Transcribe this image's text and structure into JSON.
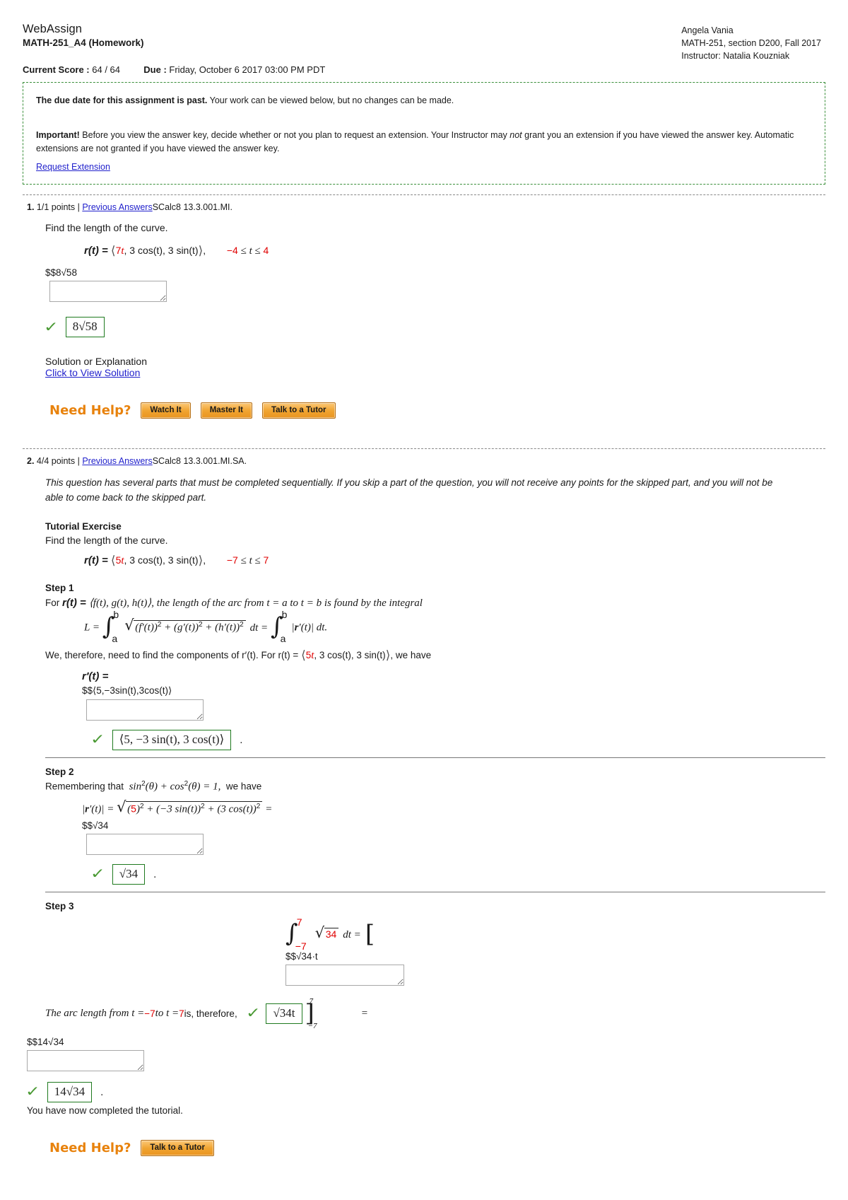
{
  "header": {
    "brand": "WebAssign",
    "assignment": "MATH-251_A4 (Homework)",
    "student": "Angela Vania",
    "course": "MATH-251, section D200, Fall 2017",
    "instructor": "Instructor: Natalia Kouzniak",
    "score_label": "Current Score :",
    "score_value": "64 / 64",
    "due_label": "Due :",
    "due_value": "Friday, October 6 2017 03:00 PM PDT"
  },
  "notice": {
    "past_due_bold": "The due date for this assignment is past.",
    "past_due_rest": " Your work can be viewed below, but no changes can be made.",
    "important_bold": "Important!",
    "important_rest_1": " Before you view the answer key, decide whether or not you plan to request an extension. Your Instructor may ",
    "important_italic": "not",
    "important_rest_2": " grant you an extension if you have viewed the answer key. Automatic extensions are not granted if you have viewed the answer key.",
    "request_extension_link": "Request Extension",
    "border_color": "#3a8f3a"
  },
  "question1": {
    "number": "1.",
    "points": "1/1 points |",
    "previous_answers_link": "Previous Answers",
    "problem_id": "SCalc8 13.3.001.MI.",
    "prompt": "Find the length of the curve.",
    "equation": {
      "lhs": "r(t) = ",
      "open_angle": "⟨",
      "coef": "7",
      "var": "t",
      "rest": ", 3 cos(t), 3 sin(t)",
      "close_angle": "⟩",
      "comma": ",",
      "domain_lo": "−4",
      "domain_mid": " ≤ t ≤ ",
      "domain_hi": "4"
    },
    "raw_answer": "$$8√58",
    "input_value": "",
    "correct_answer": "8√58",
    "solution_title": "Solution or Explanation",
    "solution_link": "Click to View Solution",
    "need_help_label": "Need Help?",
    "need_help_buttons": [
      "Watch It",
      "Master It",
      "Talk to a Tutor"
    ]
  },
  "question2": {
    "number": "2.",
    "points": "4/4 points |",
    "previous_answers_link": "Previous Answers",
    "problem_id": "SCalc8 13.3.001.MI.SA.",
    "sequential_note": "This question has several parts that must be completed sequentially. If you skip a part of the question, you will not receive any points for the skipped part, and you will not be able to come back to the skipped part.",
    "tutorial_title": "Tutorial Exercise",
    "prompt": "Find the length of the curve.",
    "equation": {
      "lhs": "r(t) = ",
      "open_angle": "⟨",
      "coef": "5",
      "var": "t",
      "rest": ", 3 cos(t), 3 sin(t)",
      "close_angle": "⟩",
      "comma": ",",
      "domain_lo": "−7",
      "domain_mid": " ≤ t ≤ ",
      "domain_hi": "7"
    },
    "step1": {
      "title": "Step 1",
      "intro_a": "For ",
      "intro_r": "r(t) = ",
      "intro_components": "⟨f(t), g(t), h(t)⟩",
      "intro_b": ",  the length of the arc from t = a to t = b is found by the integral",
      "formula_L": "L = ",
      "formula_lower": "a",
      "formula_upper": "b",
      "formula_radicand": "(f′(t))2 + (g′(t))2 + (h′(t))2",
      "formula_dt": "dt = ",
      "formula_abs": "|r′(t)| dt.",
      "text_after": "We, therefore, need to find the components of  r′(t).  For  r(t) = ",
      "text_after_vec": ", 3 cos(t), 3 sin(t)",
      "text_after_end": ",  we have",
      "rprime_label": "r′(t) =",
      "raw_answer": "$$⟨5,−3sin(t),3cos(t)⟩",
      "input_value": "",
      "correct_answer": "⟨5, −3 sin(t), 3 cos(t)⟩"
    },
    "step2": {
      "title": "Step 2",
      "intro": "Remembering that  sin2(θ) + cos2(θ) = 1,  we have",
      "lhs": "|r′(t)| = ",
      "radicand_coef": "5",
      "radicand_rest": ")2 + (−3 sin(t))2 + (3 cos(t))2",
      "equals": "=",
      "raw_answer": "$$√34",
      "input_value": "",
      "correct_answer": "√34"
    },
    "step3": {
      "title": "Step 3",
      "int_lower": "−7",
      "int_upper": "7",
      "int_radicand": "34",
      "int_dt": "dt =",
      "raw_answer": "$$√34·t",
      "input_value": "",
      "arc_text_a": "The arc length from t = ",
      "arc_lo": "−7",
      "arc_text_b": " to t = ",
      "arc_hi": "7",
      "arc_text_c": " is, therefore,",
      "correct_answer_inline": "√34t",
      "eval_upper": "7",
      "eval_lower": "−7",
      "equals": "=",
      "final_raw_answer": "$$14√34",
      "final_input_value": "",
      "final_correct_answer": "14√34",
      "completed_text": "You have now completed the tutorial."
    },
    "need_help_label": "Need Help?",
    "need_help_buttons": [
      "Talk to a Tutor"
    ]
  },
  "colors": {
    "link": "#2222cc",
    "highlight_red": "#e00000",
    "correct_green": "#1f7a1f",
    "check_green": "#4a9a34",
    "orange_accent": "#e8820c"
  }
}
